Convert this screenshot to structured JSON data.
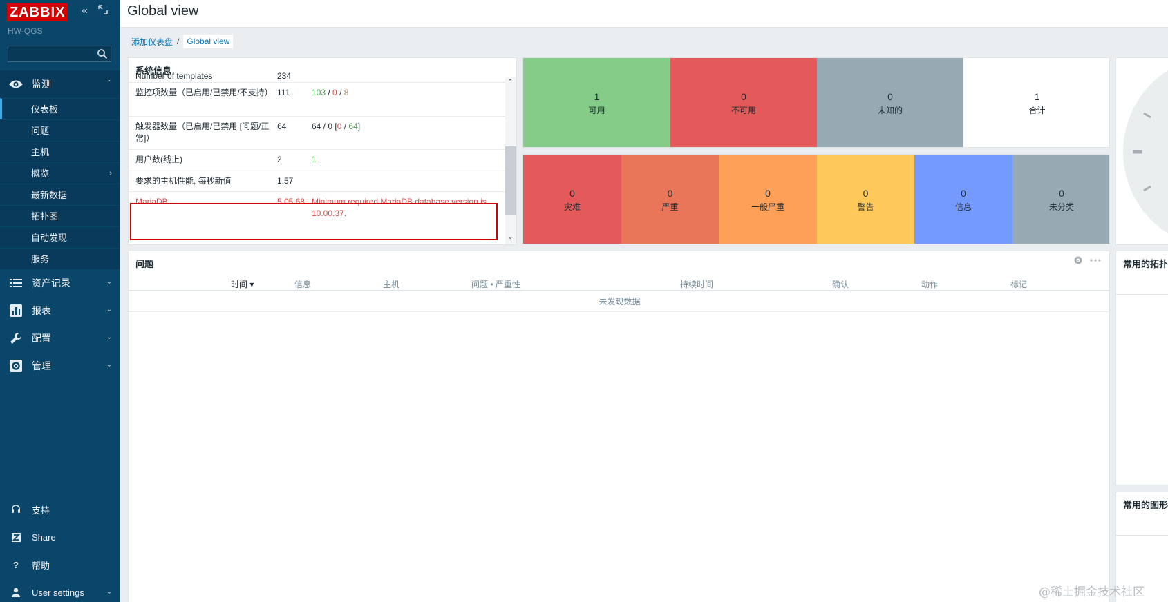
{
  "sidebar": {
    "logo": "ZABBIX",
    "server_name": "HW-QGS",
    "search_placeholder": "",
    "sections": [
      {
        "label": "监测",
        "icon": "eye-icon"
      },
      {
        "label": "资产记录",
        "icon": "list-icon"
      },
      {
        "label": "报表",
        "icon": "bar-chart-icon"
      },
      {
        "label": "配置",
        "icon": "wrench-icon"
      },
      {
        "label": "管理",
        "icon": "gear-icon"
      }
    ],
    "monitoring_items": [
      "仪表板",
      "问题",
      "主机",
      "概览",
      "最新数据",
      "拓扑图",
      "自动发现",
      "服务"
    ],
    "bottom": [
      {
        "label": "支持",
        "icon": "headset-icon"
      },
      {
        "label": "Share",
        "icon": "zabbix-share-icon"
      },
      {
        "label": "帮助",
        "icon": "question-icon"
      },
      {
        "label": "User settings",
        "icon": "user-icon"
      }
    ]
  },
  "header": {
    "title": "Global view",
    "breadcrumb": [
      "添加仪表盘",
      "Global view"
    ]
  },
  "system_info": {
    "title": "系统信息",
    "rows": [
      {
        "param": "Number of templates",
        "value": "234",
        "details": ""
      },
      {
        "param": "监控项数量（已启用/已禁用/不支持）",
        "value": "111",
        "d1": "103",
        "d2": "0",
        "d3": "8"
      },
      {
        "param": "触发器数量（已启用/已禁用 [问题/正常]）",
        "value": "64",
        "d_pre": "64 / 0 [",
        "d1": "0",
        "d2": "64",
        "d_post": "]"
      },
      {
        "param": "用户数(线上)",
        "value": "2",
        "details": "1"
      },
      {
        "param": "要求的主机性能, 每秒新值",
        "value": "1.57",
        "details": ""
      },
      {
        "param": "MariaDB",
        "value": "5.05.68",
        "details": "Minimum required MariaDB database version is 10.00.37."
      }
    ]
  },
  "host_availability": [
    {
      "count": "1",
      "label": "可用",
      "color": "#86cc89"
    },
    {
      "count": "0",
      "label": "不可用",
      "color": "#e45959"
    },
    {
      "count": "0",
      "label": "未知的",
      "color": "#97aab3"
    },
    {
      "count": "1",
      "label": "合计",
      "color": "#ffffff"
    }
  ],
  "severity": [
    {
      "count": "0",
      "label": "灾难",
      "color": "#e45959"
    },
    {
      "count": "0",
      "label": "严重",
      "color": "#e97659"
    },
    {
      "count": "0",
      "label": "一般严重",
      "color": "#ffa059"
    },
    {
      "count": "0",
      "label": "警告",
      "color": "#ffc859"
    },
    {
      "count": "0",
      "label": "信息",
      "color": "#7499ff"
    },
    {
      "count": "0",
      "label": "未分类",
      "color": "#97aab3"
    }
  ],
  "problems": {
    "title": "问题",
    "columns": [
      "时间 ▾",
      "信息",
      "主机",
      "问题 • 严重性",
      "持续时间",
      "确认",
      "动作",
      "标记"
    ],
    "empty": "未发现数据"
  },
  "right_widgets": {
    "maps_title": "常用的拓扑图",
    "graphs_title": "常用的图形"
  },
  "watermark": "@稀土掘金技术社区"
}
